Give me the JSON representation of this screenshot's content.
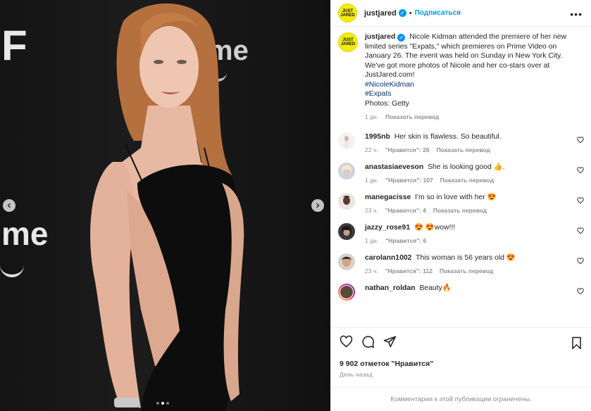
{
  "header": {
    "avatar_text": "JUST JARED",
    "username": "justjared",
    "separator": "•",
    "follow_label": "Подписаться",
    "more_label": "•••"
  },
  "caption": {
    "username": "justjared",
    "text": "Nicole Kidman attended the premiere of her new limited series \"Expats,\" which premieres on Prime Video on January 26. The event was held on Sunday in New York City. We've got more photos of Nicole and her co-stars over at JustJared.com!",
    "hashtags": [
      "#NicoleKidman",
      "#Expats"
    ],
    "credit": "Photos: Getty",
    "time": "1 дн.",
    "translate": "Показать перевод"
  },
  "comments": [
    {
      "username": "1995nb",
      "text": "Her skin is flawless. So beautiful.",
      "time": "22 ч.",
      "likes": "\"Нравится\": 26",
      "translate": "Показать перевод"
    },
    {
      "username": "anastasiaeveson",
      "text": "She is looking good 👍.",
      "time": "1 дн.",
      "likes": "\"Нравится\": 107",
      "translate": "Показать перевод"
    },
    {
      "username": "manegacisse",
      "text": "I'm so in love with her 😍",
      "time": "23 ч.",
      "likes": "\"Нравится\": 4",
      "translate": "Показать перевод"
    },
    {
      "username": "jazzy_rose91",
      "text": "😍 😍wow!!!",
      "time": "1 дн.",
      "likes": "\"Нравится\": 6",
      "translate": ""
    },
    {
      "username": "carolann1002",
      "text": "This woman is 56 years old 😍",
      "time": "23 ч.",
      "likes": "\"Нравится\": 112",
      "translate": "Показать перевод"
    },
    {
      "username": "nathan_roldan",
      "text": "Beauty🔥",
      "time": "",
      "likes": "",
      "translate": ""
    }
  ],
  "footer": {
    "likes_count": "9 902 отметок \"Нравится\"",
    "posted_ago": "День назад",
    "comments_limited": "Комментарии к этой публикации ограничены."
  },
  "media": {
    "brand_letters": [
      "F",
      "me",
      "me"
    ],
    "slide_count": 3,
    "active_slide": 2
  },
  "colors": {
    "accent": "#0095f6",
    "muted": "#8e8e8e",
    "hashtag": "#00376b",
    "brand_yellow": "#f3ea13"
  },
  "icons": [
    "chevron-left-icon",
    "chevron-right-icon",
    "verified-icon",
    "heart-icon",
    "comment-icon",
    "share-icon",
    "bookmark-icon",
    "more-icon"
  ]
}
